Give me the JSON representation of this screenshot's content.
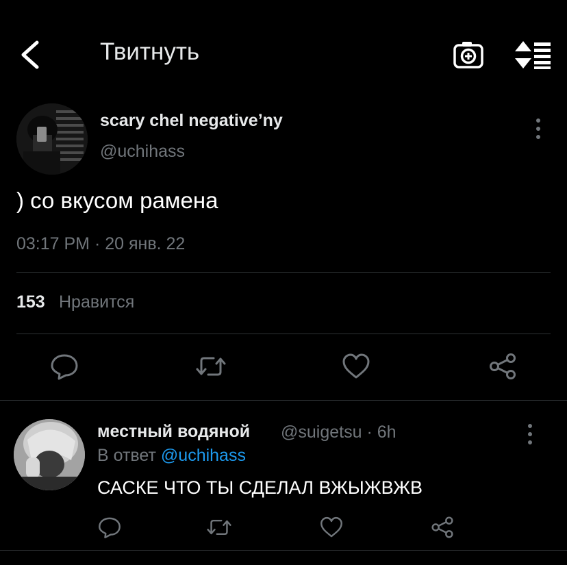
{
  "header": {
    "title": "Твитнуть"
  },
  "tweet": {
    "author_name": "scary chel negative’ny",
    "author_handle": "@uchihass",
    "text": ") со вкусом рамена",
    "timestamp": "03:17 PM · 20 янв. 22",
    "likes_count": "153",
    "likes_label": "Нравится"
  },
  "reply": {
    "author_name": "местный водяной",
    "meta": "@suigetsu · 6h",
    "reply_prefix": "В ответ",
    "reply_mention": "@uchihass",
    "text": "САСКЕ ЧТО ТЫ СДЕЛАЛ ВЖЫЖВЖВ"
  },
  "icons": {
    "back": "chevron-left-icon",
    "camera": "camera-plus-icon",
    "sort": "sort-icon",
    "more": "more-vertical-icon",
    "reply": "comment-icon",
    "retweet": "retweet-icon",
    "like": "heart-icon",
    "share": "share-icon"
  },
  "colors": {
    "background": "#000000",
    "text": "#e7e9ea",
    "secondary": "#71767b",
    "link": "#1d9bf0",
    "divider": "#2f3336"
  }
}
